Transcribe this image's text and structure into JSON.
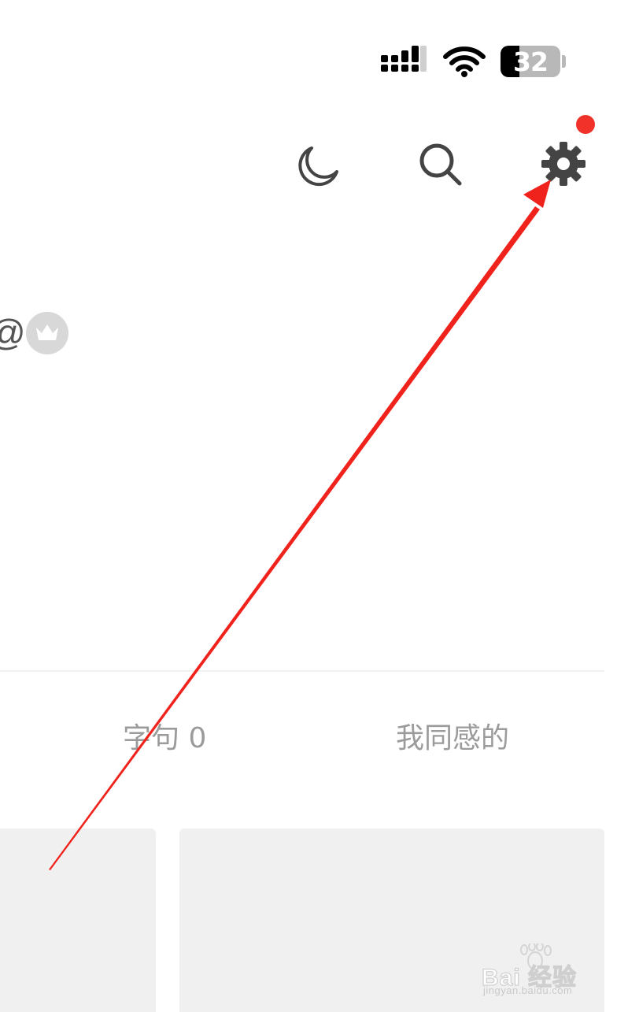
{
  "status_bar": {
    "battery_level": "32",
    "battery_fraction": 0.32,
    "icons": [
      "signal-icon",
      "wifi-icon",
      "battery-icon"
    ]
  },
  "header": {
    "icons": [
      "moon-icon",
      "search-icon",
      "gear-icon"
    ],
    "notification_dot_color": "#f0322a"
  },
  "profile": {
    "at_symbol": "@",
    "badge_icon": "crown-icon"
  },
  "tabs": [
    {
      "label": "字句 0"
    },
    {
      "label": "我同感的"
    }
  ],
  "watermark": {
    "brand": "Bai 经验",
    "url": "jingyan.baidu.com"
  },
  "colors": {
    "icon": "#444444",
    "tab_text": "#9b9b9b",
    "card_bg": "#f0f0f0",
    "annotation_arrow": "#f0231c"
  }
}
